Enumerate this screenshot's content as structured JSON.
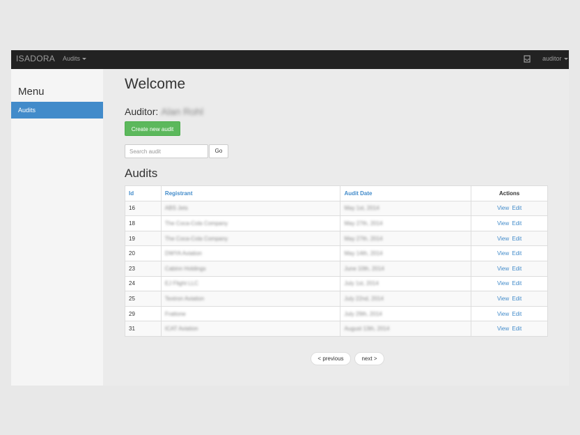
{
  "navbar": {
    "brand": "ISADORA",
    "audits_menu": "Audits",
    "inbox_icon": "inbox-icon",
    "user_menu": "auditor"
  },
  "sidebar": {
    "title": "Menu",
    "items": [
      {
        "label": "Audits",
        "active": true
      }
    ]
  },
  "main": {
    "heading": "Welcome",
    "auditor_label": "Auditor:",
    "auditor_name": "Alan Rohl",
    "create_button": "Create new audit",
    "search_placeholder": "Search audit",
    "go_button": "Go",
    "audits_heading": "Audits"
  },
  "table": {
    "headers": {
      "id": "Id",
      "registrant": "Registrant",
      "audit_date": "Audit Date",
      "actions": "Actions"
    },
    "view_label": "View",
    "edit_label": "Edit",
    "rows": [
      {
        "id": "16",
        "registrant": "ABS Jets",
        "date": "May 1st, 2014"
      },
      {
        "id": "18",
        "registrant": "The Coca-Cola Company",
        "date": "May 27th, 2014"
      },
      {
        "id": "19",
        "registrant": "The Coca-Cola Company",
        "date": "May 27th, 2014"
      },
      {
        "id": "20",
        "registrant": "DWYA Aviation",
        "date": "May 14th, 2014"
      },
      {
        "id": "23",
        "registrant": "Cabinn Holdings",
        "date": "June 10th, 2014"
      },
      {
        "id": "24",
        "registrant": "EJ Flight LLC",
        "date": "July 1st, 2014"
      },
      {
        "id": "25",
        "registrant": "Textron Aviation",
        "date": "July 22nd, 2014"
      },
      {
        "id": "29",
        "registrant": "Frattone",
        "date": "July 29th, 2014"
      },
      {
        "id": "31",
        "registrant": "ICAT Aviation",
        "date": "August 13th, 2014"
      }
    ]
  },
  "pager": {
    "previous": "< previous",
    "next": "next >"
  },
  "colors": {
    "navbar": "#222222",
    "primary": "#428bca",
    "success": "#5cb85c"
  }
}
